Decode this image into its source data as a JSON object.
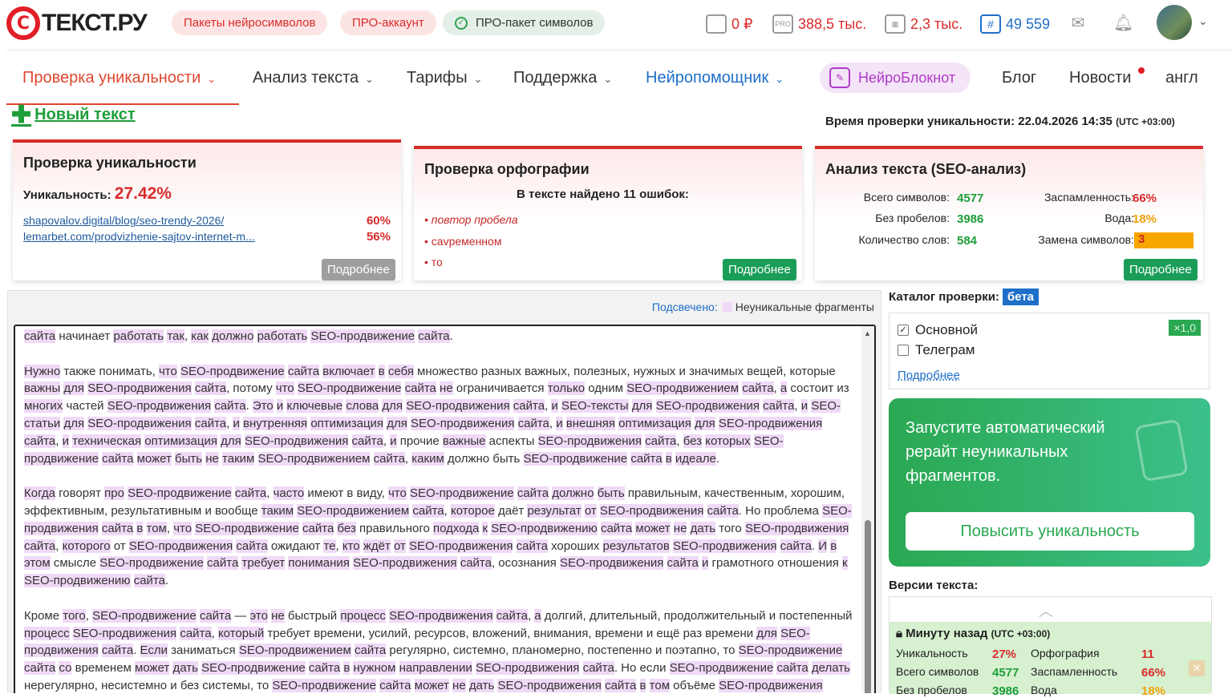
{
  "header": {
    "logo_letter": "C",
    "logo_text": "ТЕКСТ.РУ",
    "pills": [
      "Пакеты нейросимволов",
      "ПРО-аккаунт",
      "ПРО-пакет символов"
    ],
    "balance": "0 ₽",
    "pro_symbols": "388,5 тыс.",
    "calendar_symbols": "2,3 тыс.",
    "rating": "49 559"
  },
  "nav": {
    "items": [
      "Проверка уникальности",
      "Анализ текста",
      "Тарифы",
      "Поддержка",
      "Нейропомощник",
      "НейроБлокнот",
      "Блог",
      "Новости",
      "англ"
    ]
  },
  "toolbar": {
    "new_text": "Новый текст",
    "check_time_label": "Время проверки уникальности: 22.04.2026 14:35",
    "check_time_tz": "(UTC +03:00)"
  },
  "uniq_card": {
    "title": "Проверка уникальности",
    "label": "Уникальность:",
    "value": "27.42%",
    "sources": [
      {
        "url": "shapovalov.digital/blog/seo-trendy-2026/",
        "pct": "60%"
      },
      {
        "url": "lemarbet.com/prodvizhenie-sajtov-internet-m...",
        "pct": "56%"
      }
    ],
    "more": "Подробнее"
  },
  "spell_card": {
    "title": "Проверка орфографии",
    "summary": "В тексте найдено 11 ошибок:",
    "errors": [
      "повтор пробела",
      "сavременном",
      "то"
    ],
    "more": "Подробнее"
  },
  "seo_card": {
    "title": "Анализ текста (SEO-анализ)",
    "labels": [
      "Всего символов:",
      "Без пробелов:",
      "Количество слов:",
      "Заспамленность:",
      "Вода:",
      "Замена символов:"
    ],
    "values": [
      "4577",
      "3986",
      "584",
      "66%",
      "18%",
      "3"
    ],
    "more": "Подробнее"
  },
  "editor": {
    "hl_label": "Подсвечено:",
    "hl_desc": "Неуникальные фрагменты"
  },
  "catalog": {
    "title": "Каталог проверки:",
    "beta": "бета",
    "options": [
      "Основной",
      "Телеграм"
    ],
    "coef": "×1,0",
    "more": "Подробнее"
  },
  "rewrite": {
    "text": "Запустите автоматический рерайт неуникальных фрагментов.",
    "button": "Повысить уникальность"
  },
  "versions": {
    "title": "Версии текста:",
    "item_time": "Минуту назад",
    "item_tz": "(UTC +03:00)",
    "labels": [
      "Уникальность",
      "Орфография",
      "Всего символов",
      "Заспамленность",
      "Без пробелов",
      "Вода"
    ],
    "values": [
      "27%",
      "11",
      "4577",
      "66%",
      "3986",
      "18%"
    ]
  },
  "colors": {
    "accent": "#d92b2b",
    "green": "#1a9d57",
    "link": "#1e6fc8",
    "highlight": "#f0d9f7"
  }
}
